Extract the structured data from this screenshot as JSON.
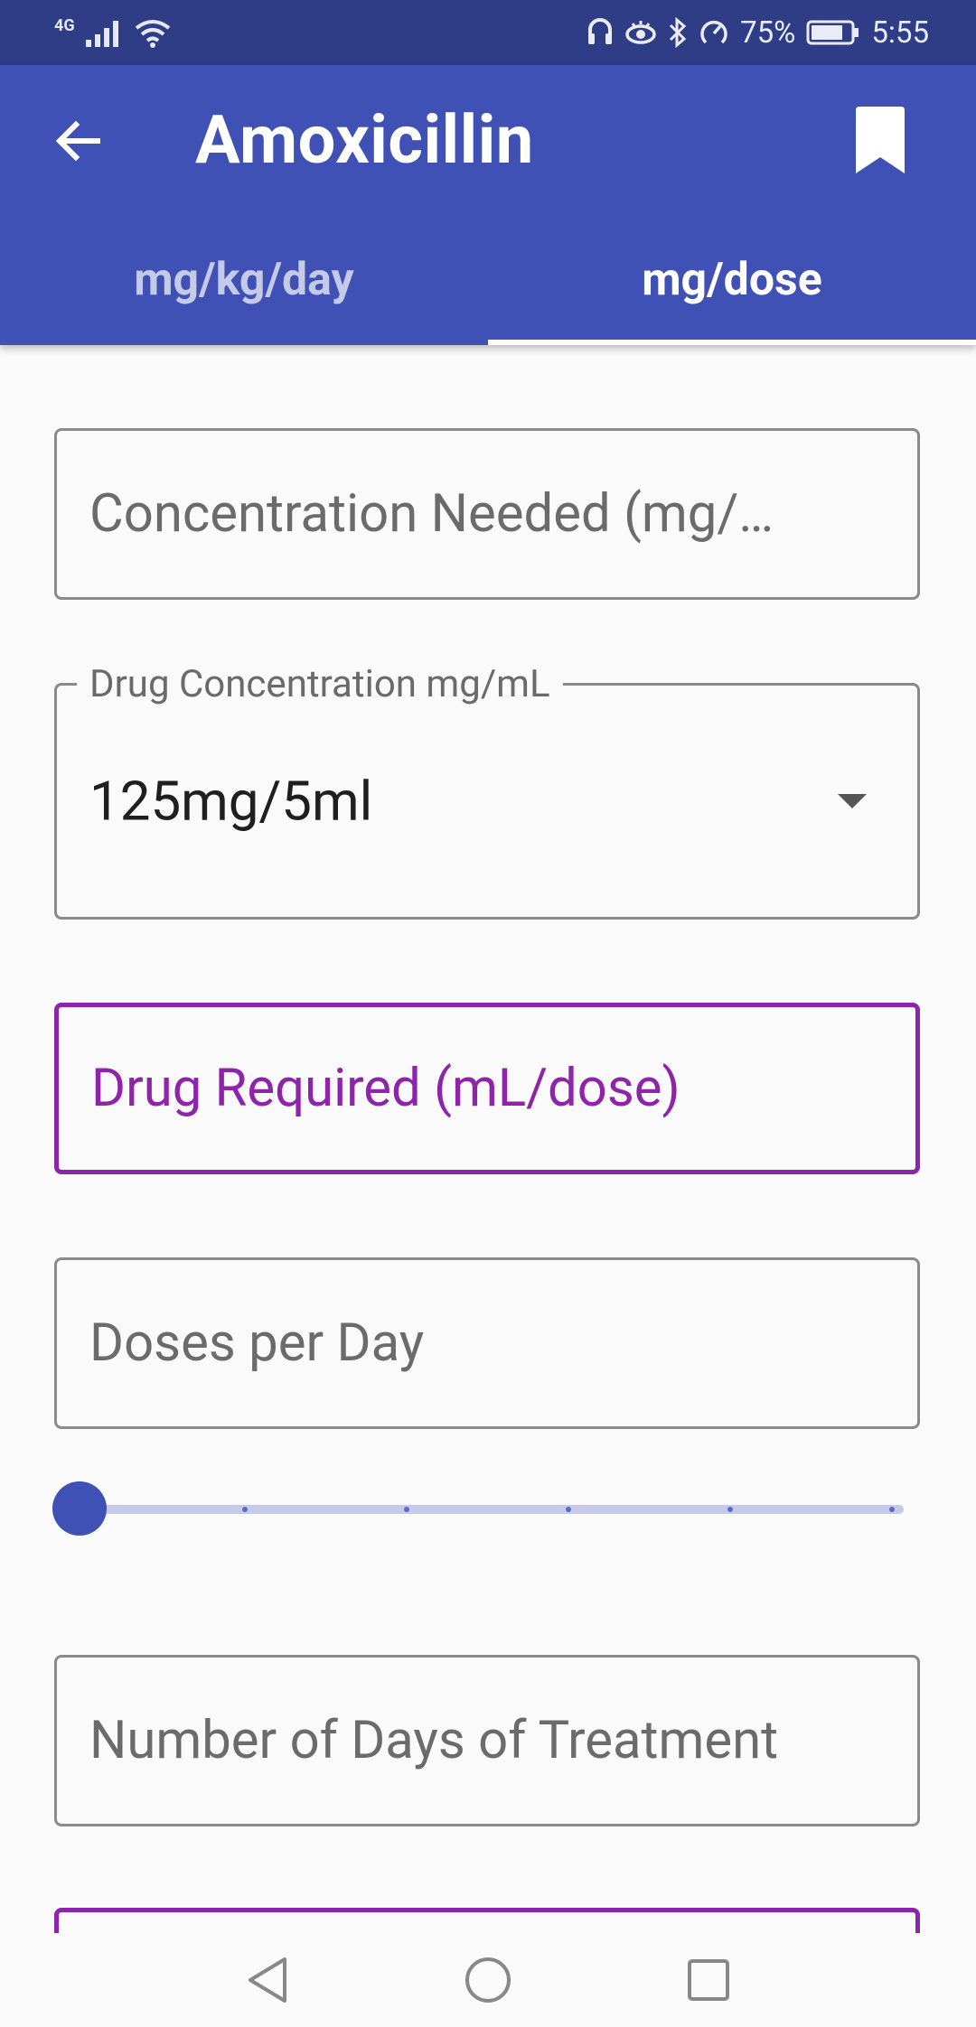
{
  "status_bar": {
    "network": "4G",
    "battery": "75%",
    "time": "5:55"
  },
  "app_bar": {
    "title": "Amoxicillin",
    "tabs": [
      {
        "label": "mg/kg/day",
        "active": false
      },
      {
        "label": "mg/dose",
        "active": true
      }
    ]
  },
  "form": {
    "concentration_needed": {
      "placeholder": "Concentration Needed (mg/…"
    },
    "drug_concentration": {
      "label": "Drug Concentration mg/mL",
      "value": "125mg/5ml"
    },
    "drug_required": {
      "placeholder": "Drug Required (mL/dose)"
    },
    "doses_per_day": {
      "placeholder": "Doses per Day"
    },
    "doses_slider": {
      "value": 0,
      "min": 0,
      "max": 5,
      "steps": 5
    },
    "days_of_treatment": {
      "placeholder": "Number of Days of Treatment"
    }
  },
  "colors": {
    "primary": "#3f51b5",
    "status_bar": "#2f3d86",
    "accent": "#8e24aa"
  }
}
